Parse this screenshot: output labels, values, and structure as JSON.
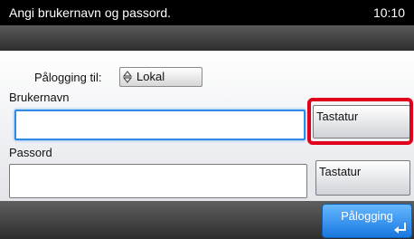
{
  "header": {
    "title": "Angi brukernavn og passord.",
    "clock": "10:10"
  },
  "login_to": {
    "label": "Pålogging til:",
    "selected": "Lokal"
  },
  "username": {
    "label": "Brukernavn",
    "value": "",
    "keyboard_label": "Tastatur"
  },
  "password": {
    "label": "Passord",
    "value": "",
    "keyboard_label": "Tastatur"
  },
  "footer": {
    "login_label": "Pålogging"
  },
  "colors": {
    "accent": "#1877df",
    "highlight": "#e1001c",
    "focus": "#2f8be5"
  },
  "icons": {
    "select": "up-down-arrows-icon",
    "enter": "enter-icon"
  }
}
